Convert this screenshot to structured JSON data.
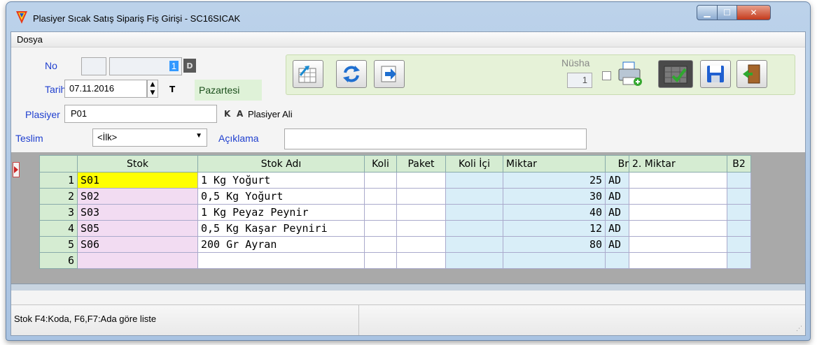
{
  "window": {
    "title": "Plasiyer Sıcak Satış Sipariş Fiş Girişi - SC16SICAK"
  },
  "menu": {
    "dosya": "Dosya"
  },
  "header": {
    "no_label": "No",
    "no_value": "1",
    "d_label": "D",
    "tarih_label": "Tarih",
    "tarih_value": "07.11.2016",
    "t_label": "T",
    "day_name": "Pazartesi",
    "plasiyer_label": "Plasiyer",
    "plasiyer_code": "P01",
    "k_label": "K",
    "a_label": "A",
    "plasiyer_name": "Plasiyer Ali",
    "teslim_label": "Teslim",
    "teslim_value": "<İlk>",
    "aciklama_label": "Açıklama",
    "aciklama_value": ""
  },
  "toolbar": {
    "nusha_label": "Nüsha",
    "nusha_value": "1"
  },
  "grid": {
    "columns": [
      "Stok",
      "Stok Adı",
      "Koli",
      "Paket",
      "Koli İçi",
      "Miktar",
      "Br",
      "2. Miktar",
      "B2"
    ],
    "rows": [
      {
        "no": "1",
        "stok": "S01",
        "stok_adi": "1 Kg Yoğurt",
        "koli": "",
        "paket": "",
        "koli_ici": "",
        "miktar": "25",
        "br": "AD",
        "miktar2": "",
        "b2": ""
      },
      {
        "no": "2",
        "stok": "S02",
        "stok_adi": "0,5 Kg Yoğurt",
        "koli": "",
        "paket": "",
        "koli_ici": "",
        "miktar": "30",
        "br": "AD",
        "miktar2": "",
        "b2": ""
      },
      {
        "no": "3",
        "stok": "S03",
        "stok_adi": "1 Kg Peyaz Peynir",
        "koli": "",
        "paket": "",
        "koli_ici": "",
        "miktar": "40",
        "br": "AD",
        "miktar2": "",
        "b2": ""
      },
      {
        "no": "4",
        "stok": "S05",
        "stok_adi": "0,5 Kg Kaşar Peyniri",
        "koli": "",
        "paket": "",
        "koli_ici": "",
        "miktar": "12",
        "br": "AD",
        "miktar2": "",
        "b2": ""
      },
      {
        "no": "5",
        "stok": "S06",
        "stok_adi": "200 Gr Ayran",
        "koli": "",
        "paket": "",
        "koli_ici": "",
        "miktar": "80",
        "br": "AD",
        "miktar2": "",
        "b2": ""
      },
      {
        "no": "6",
        "stok": "",
        "stok_adi": "",
        "koli": "",
        "paket": "",
        "koli_ici": "",
        "miktar": "",
        "br": "",
        "miktar2": "",
        "b2": ""
      }
    ]
  },
  "status": {
    "hint": "Stok F4:Koda, F6,F7:Ada göre liste"
  },
  "icons": {
    "grid_new": "table-grid-icon",
    "refresh": "refresh-arrows-icon",
    "next": "arrow-right-icon",
    "print": "printer-icon",
    "check_table": "checked-table-icon",
    "save": "floppy-disk-icon",
    "exit": "door-exit-icon"
  },
  "colors": {
    "active_cell": "#ffff00",
    "label_blue": "#1f3fcf",
    "stok_column": "#f2dcf2",
    "header_green": "#d5ecd2"
  }
}
